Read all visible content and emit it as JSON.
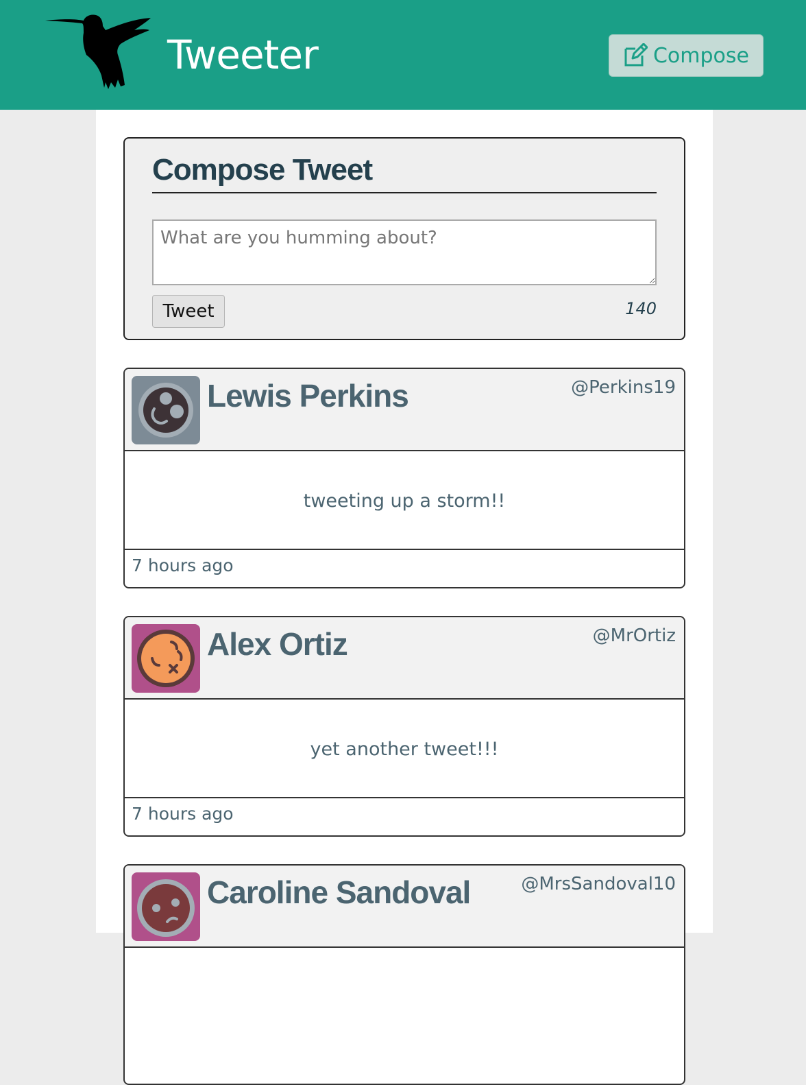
{
  "navbar": {
    "brand": "Tweeter",
    "compose_label": "Compose",
    "color": "#1a9f87"
  },
  "compose": {
    "title": "Compose Tweet",
    "placeholder": "What are you humming about?",
    "submit_label": "Tweet",
    "counter": "140"
  },
  "tweets": [
    {
      "name": "Lewis Perkins",
      "handle": "@Perkins19",
      "content": "tweeting up a storm!!",
      "time": "7 hours ago",
      "avatar_icon": "planet-avatar-icon",
      "avatar_bg": "#7d8b96"
    },
    {
      "name": "Alex Ortiz",
      "handle": "@MrOrtiz",
      "content": "yet another tweet!!!",
      "time": "7 hours ago",
      "avatar_icon": "orange-face-avatar-icon",
      "avatar_bg": "#b0508a"
    },
    {
      "name": "Caroline Sandoval",
      "handle": "@MrsSandoval10",
      "content": "",
      "time": "",
      "avatar_icon": "sad-face-avatar-icon",
      "avatar_bg": "#b0508a"
    }
  ]
}
